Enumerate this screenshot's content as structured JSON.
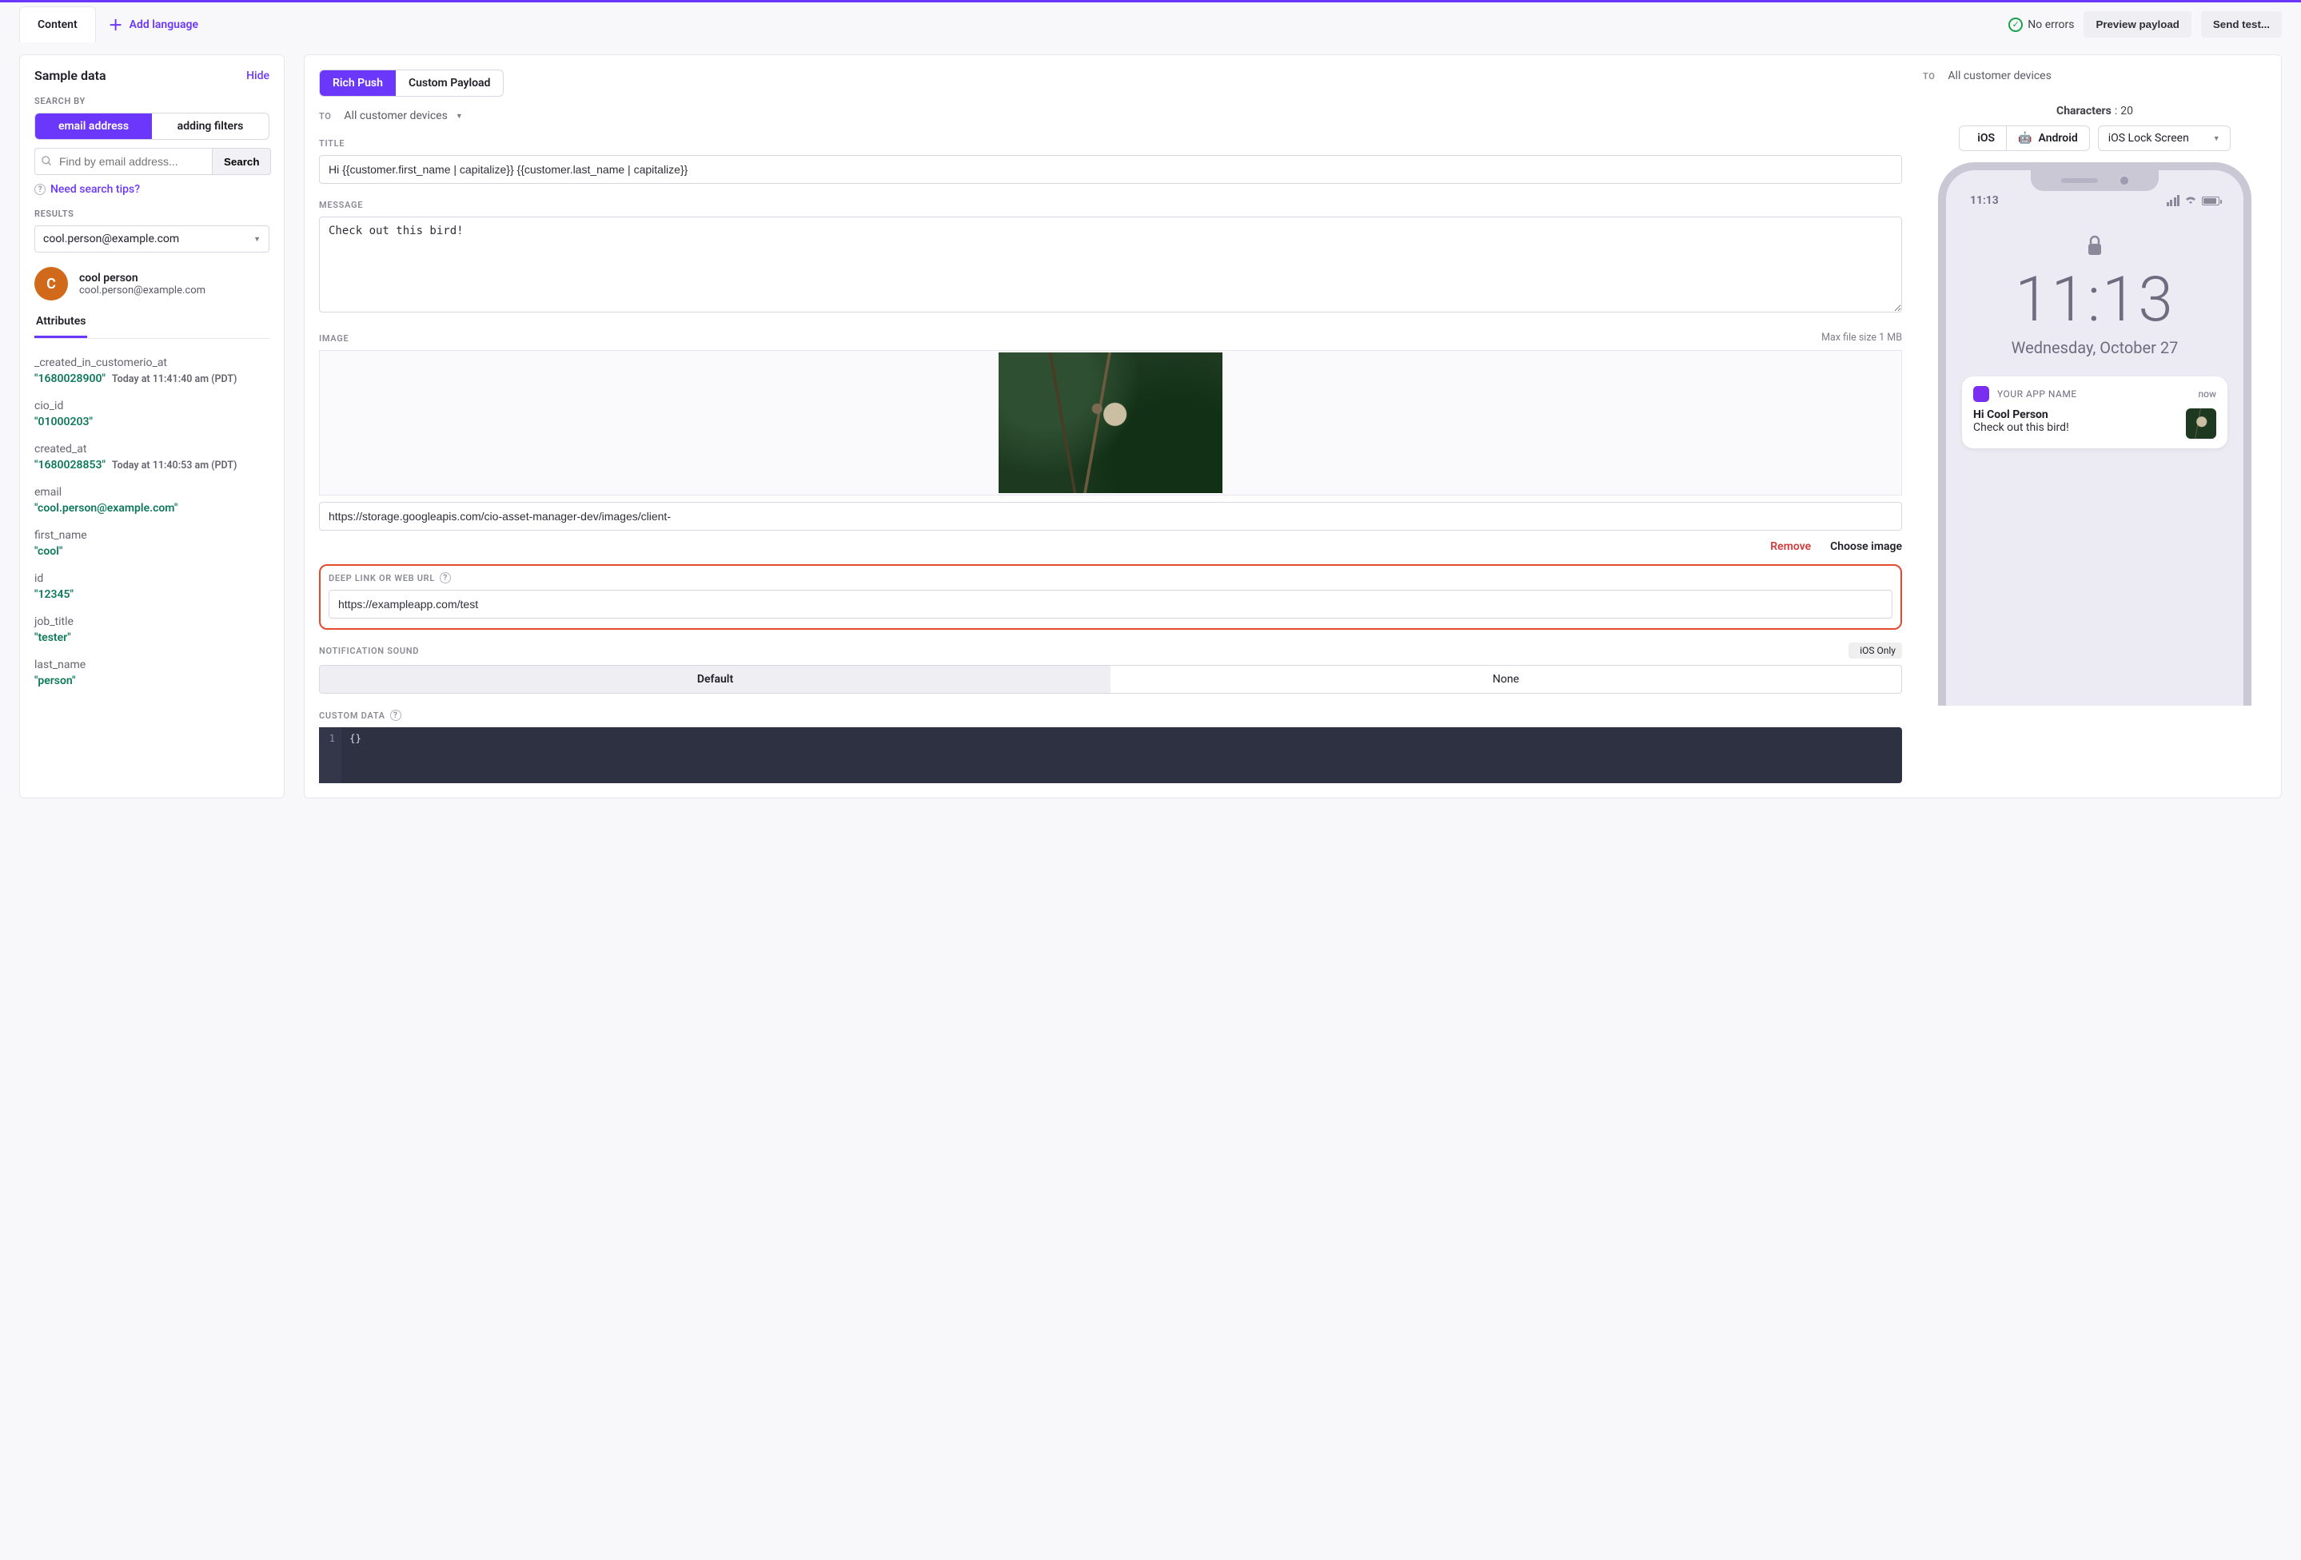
{
  "topbar": {
    "content_tab": "Content",
    "add_language": "Add language",
    "no_errors": "No errors",
    "preview_payload": "Preview payload",
    "send_test": "Send test..."
  },
  "sample": {
    "title": "Sample data",
    "hide": "Hide",
    "search_by": "SEARCH BY",
    "seg_email": "email address",
    "seg_filters": "adding filters",
    "search_placeholder": "Find by email address...",
    "search_btn": "Search",
    "tips": "Need search tips?",
    "results": "RESULTS",
    "result_option": "cool.person@example.com",
    "user": {
      "initial": "C",
      "name": "cool person",
      "email": "cool.person@example.com"
    },
    "subtab": "Attributes",
    "attrs": [
      {
        "k": "_created_in_customerio_at",
        "v": "\"1680028900\"",
        "meta": "Today at 11:41:40 am (PDT)"
      },
      {
        "k": "cio_id",
        "v": "\"01000203\""
      },
      {
        "k": "created_at",
        "v": "\"1680028853\"",
        "meta": "Today at 11:40:53 am (PDT)"
      },
      {
        "k": "email",
        "v": "\"cool.person@example.com\""
      },
      {
        "k": "first_name",
        "v": "\"cool\""
      },
      {
        "k": "id",
        "v": "\"12345\""
      },
      {
        "k": "job_title",
        "v": "\"tester\""
      },
      {
        "k": "last_name",
        "v": "\"person\""
      }
    ]
  },
  "editor": {
    "tab_rich": "Rich Push",
    "tab_custom": "Custom Payload",
    "to_label": "TO",
    "to_value": "All customer devices",
    "title_label": "TITLE",
    "title_value": "Hi {{customer.first_name | capitalize}} {{customer.last_name | capitalize}}",
    "message_label": "MESSAGE",
    "message_value": "Check out this bird!",
    "image_label": "IMAGE",
    "image_max": "Max file size 1 MB",
    "image_url": "https://storage.googleapis.com/cio-asset-manager-dev/images/client-",
    "remove": "Remove",
    "choose": "Choose image",
    "deeplink_label": "DEEP LINK OR WEB URL",
    "deeplink_value": "https://exampleapp.com/test",
    "sound_label": "NOTIFICATION SOUND",
    "ios_only": "iOS Only",
    "sound_default": "Default",
    "sound_none": "None",
    "custom_label": "CUSTOM DATA",
    "custom_line": "1",
    "custom_code": "{}"
  },
  "preview": {
    "to_label": "TO",
    "to_value": "All customer devices",
    "characters_label": "Characters",
    "characters": "20",
    "os_ios": "iOS",
    "os_android": "Android",
    "screen": "iOS Lock Screen",
    "status_time": "11:13",
    "big_time": "11:13",
    "date": "Wednesday, October 27",
    "notif": {
      "app": "YOUR APP NAME",
      "time": "now",
      "title": "Hi Cool Person",
      "message": "Check out this bird!"
    }
  }
}
